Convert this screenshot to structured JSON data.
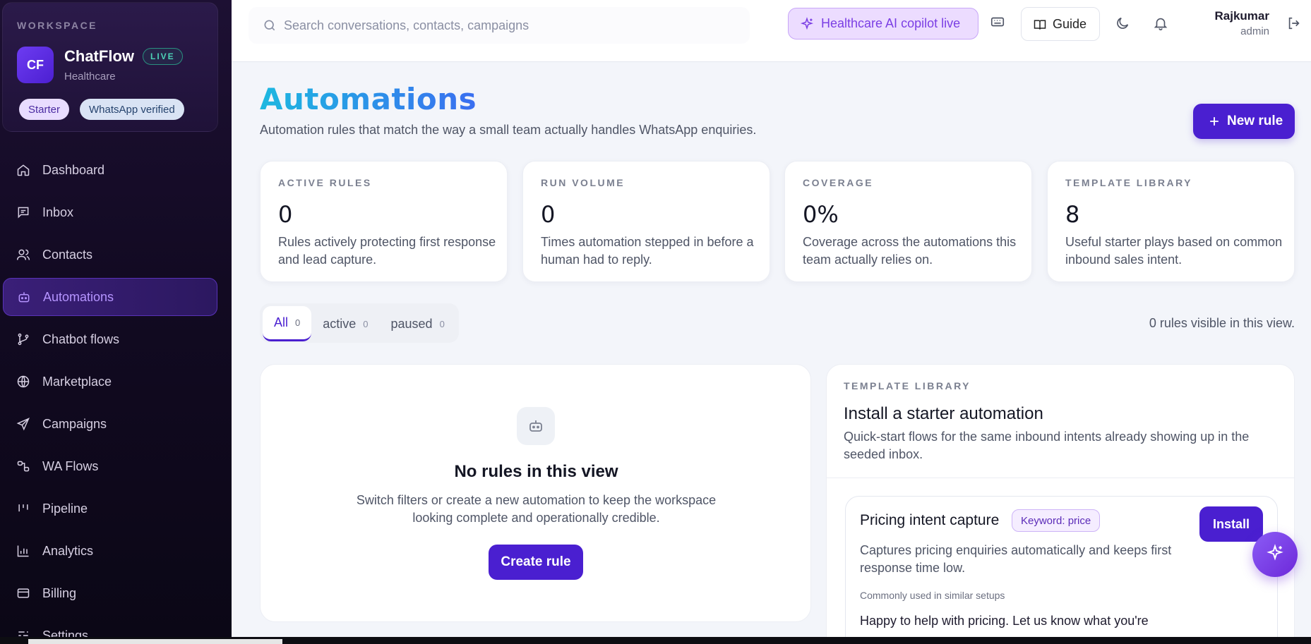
{
  "workspace": {
    "label": "WORKSPACE",
    "avatar": "CF",
    "name": "ChatFlow",
    "live": "LIVE",
    "industry": "Healthcare",
    "plan": "Starter",
    "verified": "WhatsApp verified"
  },
  "nav": {
    "items": [
      {
        "label": "Dashboard",
        "icon": "home-icon"
      },
      {
        "label": "Inbox",
        "icon": "message-icon"
      },
      {
        "label": "Contacts",
        "icon": "users-icon"
      },
      {
        "label": "Automations",
        "icon": "bot-icon",
        "active": true
      },
      {
        "label": "Chatbot flows",
        "icon": "branch-icon"
      },
      {
        "label": "Marketplace",
        "icon": "globe-icon"
      },
      {
        "label": "Campaigns",
        "icon": "send-icon"
      },
      {
        "label": "WA Flows",
        "icon": "flow-icon"
      },
      {
        "label": "Pipeline",
        "icon": "pipeline-icon"
      },
      {
        "label": "Analytics",
        "icon": "chart-icon"
      },
      {
        "label": "Billing",
        "icon": "card-icon"
      },
      {
        "label": "Settings",
        "icon": "settings-icon"
      }
    ]
  },
  "topbar": {
    "search_placeholder": "Search conversations, contacts, campaigns",
    "copilot": "Healthcare AI copilot live",
    "guide": "Guide",
    "user_name": "Rajkumar",
    "user_role": "admin"
  },
  "page": {
    "title": "Automations",
    "subtitle": "Automation rules that match the way a small team actually handles WhatsApp enquiries.",
    "new_rule": "New rule"
  },
  "stats": [
    {
      "label": "ACTIVE RULES",
      "value": "0",
      "desc": "Rules actively protecting first response and lead capture."
    },
    {
      "label": "RUN VOLUME",
      "value": "0",
      "desc": "Times automation stepped in before a human had to reply."
    },
    {
      "label": "COVERAGE",
      "value": "0%",
      "desc": "Coverage across the automations this team actually relies on."
    },
    {
      "label": "TEMPLATE LIBRARY",
      "value": "8",
      "desc": "Useful starter plays based on common inbound sales intent."
    }
  ],
  "filters": {
    "tabs": [
      {
        "label": "All",
        "count": "0"
      },
      {
        "label": "active",
        "count": "0"
      },
      {
        "label": "paused",
        "count": "0"
      }
    ],
    "visible_text": "0 rules visible in this view."
  },
  "empty_state": {
    "title": "No rules in this view",
    "desc": "Switch filters or create a new automation to keep the workspace looking complete and operationally credible.",
    "button": "Create rule"
  },
  "library": {
    "label": "TEMPLATE LIBRARY",
    "title": "Install a starter automation",
    "desc": "Quick-start flows for the same inbound intents already showing up in the seeded inbox.",
    "template": {
      "title": "Pricing intent capture",
      "badge": "Keyword: price",
      "install": "Install",
      "desc": "Captures pricing enquiries automatically and keeps first response time low.",
      "note": "Commonly used in similar setups",
      "message": "Happy to help with pricing. Let us know what you're"
    }
  },
  "colors": {
    "accent": "#4a1fd0",
    "sidebar_bg": "#120a22",
    "copilot_bg": "#ecdcff",
    "live": "#4dd1b6"
  }
}
